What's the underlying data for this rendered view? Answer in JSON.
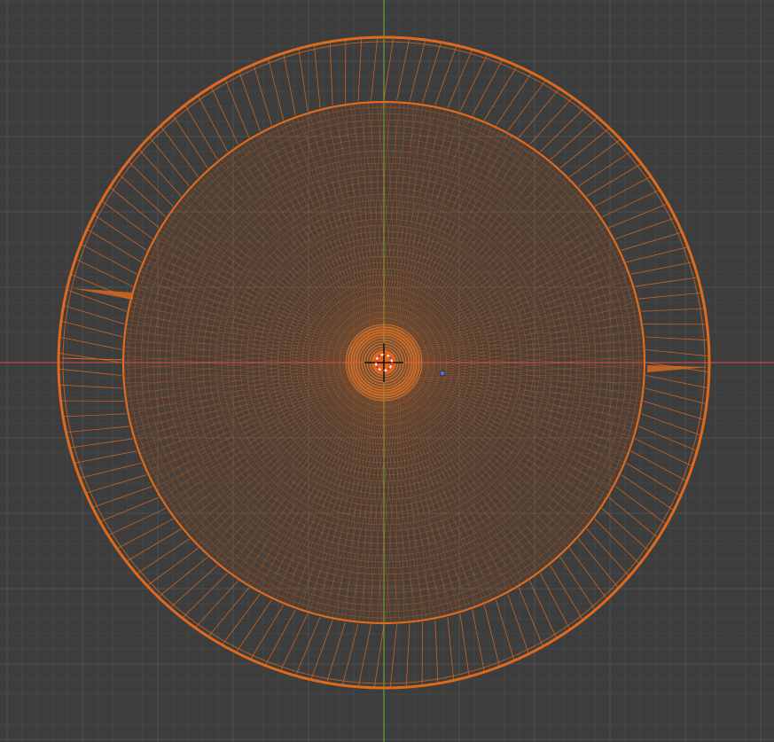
{
  "viewport": {
    "view": "top-orthographic",
    "shading": "wireframe",
    "selection_state": "selected",
    "object_type": "mesh"
  },
  "colors": {
    "background": "#3d3d3d",
    "grid_minor": "#454545",
    "grid_major": "#505050",
    "axis_x": "#c0494f",
    "axis_y": "#6a9e3a",
    "wire_selected": "#e06a1c",
    "wire_bright": "#f08a3a",
    "cursor_red": "#e03030",
    "cursor_white": "#ffffff",
    "cursor_black": "#111111",
    "origin_dot": "#5a6fc0"
  },
  "icons": {
    "cursor": "3d-cursor-icon",
    "origin": "object-origin-icon"
  }
}
